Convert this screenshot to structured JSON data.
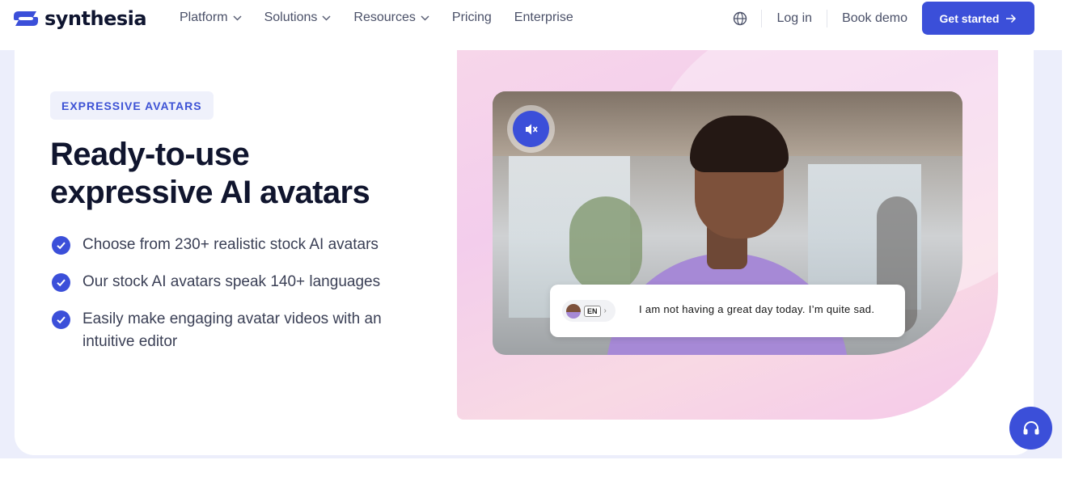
{
  "brand": {
    "name": "synthesia",
    "accent_color": "#3b4fd9",
    "logo_icon": "synthesia-logo-icon"
  },
  "nav": {
    "items": [
      {
        "label": "Platform",
        "has_dropdown": true
      },
      {
        "label": "Solutions",
        "has_dropdown": true
      },
      {
        "label": "Resources",
        "has_dropdown": true
      },
      {
        "label": "Pricing",
        "has_dropdown": false
      },
      {
        "label": "Enterprise",
        "has_dropdown": false
      }
    ],
    "globe_icon": "globe-icon",
    "login_label": "Log in",
    "demo_label": "Book demo",
    "cta_label": "Get started",
    "cta_icon": "arrow-right-icon"
  },
  "hero": {
    "eyebrow": "EXPRESSIVE AVATARS",
    "title_line1": "Ready-to-use",
    "title_line2": "expressive AI avatars",
    "features": [
      "Choose from 230+ realistic stock AI avatars",
      "Our stock AI avatars speak 140+ languages",
      "Easily make engaging avatar videos with an intuitive editor"
    ]
  },
  "video": {
    "mute_icon": "speaker-muted-icon",
    "caption": {
      "language": "EN",
      "text": "I am not having a great day today. I’m quite sad."
    }
  },
  "support": {
    "icon": "headset-icon"
  }
}
